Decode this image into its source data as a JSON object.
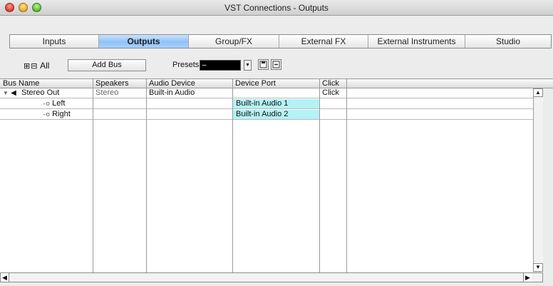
{
  "window": {
    "title": "VST Connections - Outputs"
  },
  "tabs": [
    {
      "label": "Inputs"
    },
    {
      "label": "Outputs"
    },
    {
      "label": "Group/FX"
    },
    {
      "label": "External FX"
    },
    {
      "label": "External Instruments"
    },
    {
      "label": "Studio"
    }
  ],
  "toolbar": {
    "expand_icons": "⊞⊟",
    "all_label": "All",
    "add_bus_label": "Add Bus",
    "presets_label": "Presets",
    "presets_value": "–"
  },
  "table": {
    "columns": [
      "Bus Name",
      "Speakers",
      "Audio Device",
      "Device Port",
      "Click"
    ],
    "rows": [
      {
        "name": "Stereo Out",
        "speakers": "Stereo",
        "device": "Built-in Audio",
        "port": "",
        "click": "Click"
      },
      {
        "name": "Left",
        "speakers": "",
        "device": "",
        "port": "Built-in Audio 1",
        "click": ""
      },
      {
        "name": "Right",
        "speakers": "",
        "device": "",
        "port": "Built-in Audio 2",
        "click": ""
      }
    ]
  },
  "colors": {
    "active_tab": "#8fc2f6",
    "port_highlight": "#b4f2f5"
  }
}
